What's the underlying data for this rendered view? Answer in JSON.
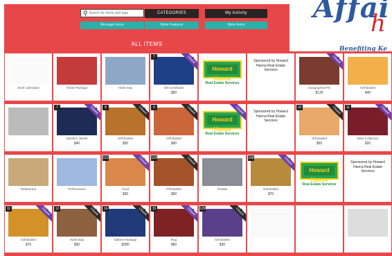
{
  "header": {
    "search_placeholder": "Search for items and tags",
    "categories_label": "CATEGORIES",
    "my_activity_label": "My Activity",
    "message_donor_label": "Message donor",
    "more_features_label": "More Features",
    "more_items_label": "More Items",
    "all_items_title": "ALL ITEMS"
  },
  "logo": {
    "title_part1": "Affai",
    "title_part2": "h",
    "subtitle": "Benefiting Ke"
  },
  "colors": {
    "brand_red": "#e8474a",
    "teal": "#29b0a8",
    "dark": "#2a2323",
    "logo_blue": "#2e5a9e",
    "hh_green": "#29a64a",
    "hh_yellow": "#f5d21c"
  },
  "hh": {
    "brand": "Howard Hanna",
    "caption": "Real Estate Services"
  },
  "items": [
    {
      "num": "",
      "title": "2018 Calendars",
      "price": "",
      "badge": "",
      "img": "blank"
    },
    {
      "num": "",
      "title": "Ticket Package",
      "price": "",
      "badge": "",
      "img": "stage"
    },
    {
      "num": "",
      "title": "Hotel Stay",
      "price": "",
      "badge": "",
      "img": "building"
    },
    {
      "num": "7",
      "title": "Gift Certificate",
      "price": "$90",
      "badge": "Closed",
      "img": "optics"
    },
    {
      "num": "",
      "title": "",
      "price": "",
      "badge": "",
      "img": "hh"
    },
    {
      "num": "",
      "title": "",
      "price": "",
      "badge": "",
      "img": "sponsor"
    },
    {
      "num": "",
      "title": "Autographed Pic",
      "price": "$135",
      "badge": "Closed",
      "img": "photo"
    },
    {
      "num": "",
      "title": "Gift Basket",
      "price": "$40",
      "badge": "",
      "img": "orange"
    },
    {
      "num": "",
      "title": "",
      "price": "",
      "badge": "",
      "img": "grey"
    },
    {
      "num": "7",
      "title": "Steelers Jacket",
      "price": "$40",
      "badge": "Closed",
      "img": "jacket"
    },
    {
      "num": "8",
      "title": "Gift Basket",
      "price": "$50",
      "badge": "Closed",
      "img": "basket"
    },
    {
      "num": "9",
      "title": "Gift Basket",
      "price": "$90",
      "badge": "Closed",
      "img": "basket2"
    },
    {
      "num": "",
      "title": "",
      "price": "",
      "badge": "Closed",
      "img": "hh"
    },
    {
      "num": "",
      "title": "",
      "price": "",
      "badge": "",
      "img": "sponsor"
    },
    {
      "num": "10",
      "title": "Gift Basket",
      "price": "$55",
      "badge": "Closed",
      "img": "snacks"
    },
    {
      "num": "11",
      "title": "Wine Collection",
      "price": "$20",
      "badge": "Closed",
      "img": "wine"
    },
    {
      "num": "",
      "title": "Restaurant",
      "price": "",
      "badge": "",
      "img": "kiosk"
    },
    {
      "num": "",
      "title": "Performance",
      "price": "",
      "badge": "",
      "img": "dancer"
    },
    {
      "num": "101",
      "title": "Food",
      "price": "$90",
      "badge": "Closed",
      "img": "food"
    },
    {
      "num": "104",
      "title": "Gift Basket",
      "price": "$90",
      "badge": "Closed",
      "img": "basket3"
    },
    {
      "num": "",
      "title": "Theater",
      "price": "",
      "badge": "",
      "img": "theater"
    },
    {
      "num": "106",
      "title": "Gift Basket",
      "price": "$70",
      "badge": "Closed",
      "img": "bread"
    },
    {
      "num": "",
      "title": "",
      "price": "",
      "badge": "",
      "img": "hh"
    },
    {
      "num": "",
      "title": "",
      "price": "",
      "badge": "",
      "img": "sponsor"
    },
    {
      "num": "11",
      "title": "Gift Basket",
      "price": "$75",
      "badge": "Closed",
      "img": "drinks"
    },
    {
      "num": "12",
      "title": "Hotel Stay",
      "price": "$90",
      "badge": "Closed",
      "img": "hotel2"
    },
    {
      "num": "14",
      "title": "Sabres Package",
      "price": "$280",
      "badge": "Closed",
      "img": "sabres"
    },
    {
      "num": "15",
      "title": "Rug",
      "price": "$80",
      "badge": "Closed",
      "img": "rug"
    },
    {
      "num": "129",
      "title": "Gift Basket",
      "price": "$30",
      "badge": "Closed",
      "img": "purple"
    },
    {
      "num": "",
      "title": "",
      "price": "",
      "badge": "",
      "img": "faint"
    },
    {
      "num": "",
      "title": "",
      "price": "",
      "badge": "",
      "img": "blank2"
    },
    {
      "num": "",
      "title": "",
      "price": "",
      "badge": "",
      "img": "phone"
    }
  ],
  "sponsor_text": "Sponsored by Howard Hanna Real Estate Services"
}
